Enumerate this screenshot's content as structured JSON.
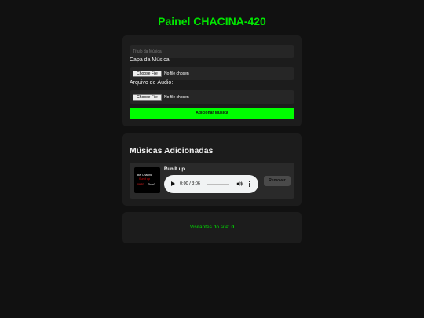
{
  "header": {
    "title": "Painel CHACINA-420"
  },
  "form": {
    "title_placeholder": "Título da Música",
    "cover_label": "Capa da Música:",
    "audio_label": "Arquivo de Áudio:",
    "choose_file_label": "Choose File",
    "no_file_text": "No file chosen",
    "add_button_label": "Adicionar Música"
  },
  "songs_section": {
    "title": "Músicas Adicionadas",
    "items": [
      {
        "name": "Run It up",
        "cover_text": [
          "Bel Chacina",
          "Run it up",
          "09:57",
          "Tlo a7"
        ],
        "player": {
          "time": "0:00 / 3:06",
          "progress": 0.0
        },
        "remove_label": "Remover"
      }
    ]
  },
  "visitors": {
    "label": "Visitantes do site:",
    "count": "0"
  },
  "colors": {
    "accent": "#00ff00",
    "background": "#111111",
    "card": "#1c1c1c"
  }
}
